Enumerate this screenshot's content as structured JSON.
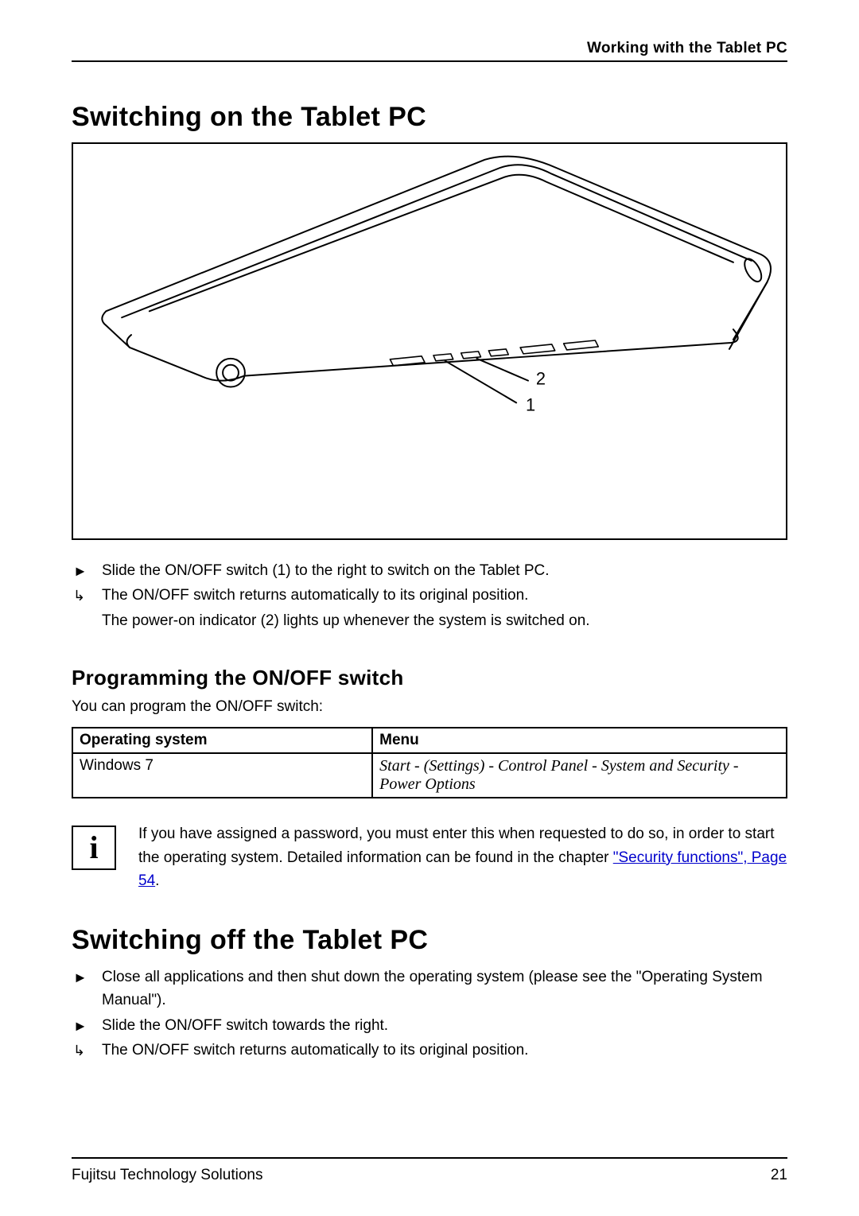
{
  "header": {
    "chapter_title": "Working with the Tablet PC"
  },
  "section1": {
    "title": "Switching on the Tablet PC",
    "figure": {
      "callouts": [
        "1",
        "2"
      ]
    },
    "steps": [
      {
        "marker": "►",
        "text": "Slide the ON/OFF switch (1) to the right to switch on the Tablet PC."
      },
      {
        "marker": "↳",
        "text": "The ON/OFF switch returns automatically to its original position."
      },
      {
        "marker": "",
        "text": "The power-on indicator (2) lights up whenever the system is switched on."
      }
    ]
  },
  "section2": {
    "title": "Programming the ON/OFF switch",
    "intro": "You can program the ON/OFF switch:",
    "table": {
      "headers": [
        "Operating system",
        "Menu"
      ],
      "rows": [
        {
          "os": "Windows 7",
          "menu": "Start - (Settings) - Control Panel - System and Security - Power Options"
        }
      ]
    },
    "info_note": {
      "icon_label": "i",
      "text_before": "If you have assigned a password, you must enter this when requested to do so, in order to start the operating system. Detailed information can be found in the chapter ",
      "link_text": "\"Security functions\", Page 54",
      "text_after": "."
    }
  },
  "section3": {
    "title": "Switching off the Tablet PC",
    "steps": [
      {
        "marker": "►",
        "text": "Close all applications and then shut down the operating system (please see the \"Operating System Manual\")."
      },
      {
        "marker": "►",
        "text": "Slide the ON/OFF switch towards the right."
      },
      {
        "marker": "↳",
        "text": "The ON/OFF switch returns automatically to its original position."
      }
    ]
  },
  "footer": {
    "left": "Fujitsu Technology Solutions",
    "right": "21"
  }
}
